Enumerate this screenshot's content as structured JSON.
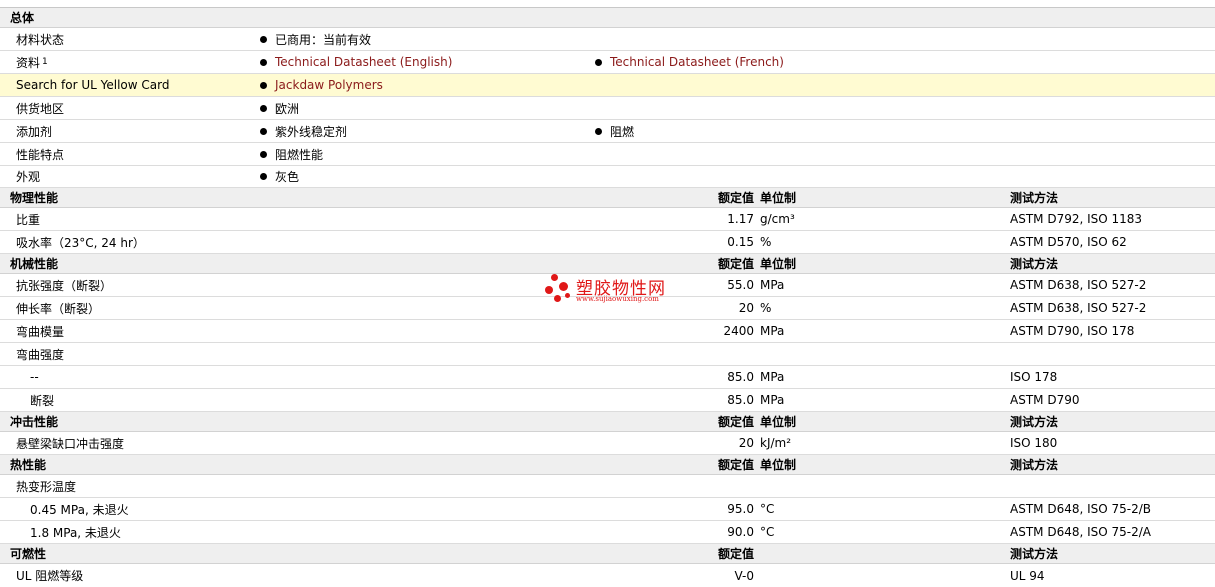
{
  "general": {
    "title": "总体",
    "material_status": {
      "label": "材料状态",
      "value": "已商用：当前有效"
    },
    "documents": {
      "label": "资料",
      "sup": "1",
      "links": [
        "Technical Datasheet (English)",
        "Technical Datasheet (French)"
      ]
    },
    "ul": {
      "label": "Search for UL Yellow Card",
      "link": "Jackdaw Polymers"
    },
    "region": {
      "label": "供货地区",
      "value": "欧洲"
    },
    "additives": {
      "label": "添加剂",
      "values": [
        "紫外线稳定剂",
        "阻燃"
      ]
    },
    "features": {
      "label": "性能特点",
      "value": "阻燃性能"
    },
    "appearance": {
      "label": "外观",
      "value": "灰色"
    }
  },
  "headers": {
    "nominal": "额定值",
    "unit": "单位制",
    "method": "测试方法"
  },
  "physical": {
    "title": "物理性能",
    "rows": [
      {
        "label": "比重",
        "value": "1.17",
        "unit": "g/cm³",
        "method": "ASTM D792, ISO 1183"
      },
      {
        "label": "吸水率（23°C, 24 hr）",
        "value": "0.15",
        "unit": "%",
        "method": "ASTM D570, ISO 62"
      }
    ]
  },
  "mechanical": {
    "title": "机械性能",
    "rows": [
      {
        "label": "抗张强度（断裂）",
        "value": "55.0",
        "unit": "MPa",
        "method": "ASTM D638, ISO 527-2"
      },
      {
        "label": "伸长率（断裂）",
        "value": "20",
        "unit": "%",
        "method": "ASTM D638, ISO 527-2"
      },
      {
        "label": "弯曲模量",
        "value": "2400",
        "unit": "MPa",
        "method": "ASTM D790, ISO 178"
      }
    ],
    "flex_strength": {
      "label": "弯曲强度",
      "rows": [
        {
          "label": "--",
          "value": "85.0",
          "unit": "MPa",
          "method": "ISO 178"
        },
        {
          "label": "断裂",
          "value": "85.0",
          "unit": "MPa",
          "method": "ASTM D790"
        }
      ]
    }
  },
  "impact": {
    "title": "冲击性能",
    "rows": [
      {
        "label": "悬壁梁缺口冲击强度",
        "value": "20",
        "unit": "kJ/m²",
        "method": "ISO 180"
      }
    ]
  },
  "thermal": {
    "title": "热性能",
    "hdt": {
      "label": "热变形温度",
      "rows": [
        {
          "label": "0.45 MPa, 未退火",
          "value": "95.0",
          "unit": "°C",
          "method": "ASTM D648, ISO 75-2/B"
        },
        {
          "label": "1.8 MPa, 未退火",
          "value": "90.0",
          "unit": "°C",
          "method": "ASTM D648, ISO 75-2/A"
        }
      ]
    }
  },
  "flammability": {
    "title": "可燃性",
    "rows": [
      {
        "label": "UL 阻燃等级",
        "value": "V-0",
        "method": "UL 94"
      }
    ]
  },
  "watermark": {
    "text": "塑胶物性网",
    "url": "www.sujiaowuxing.com",
    "color": "#e01818"
  },
  "colors": {
    "link": "#8b1a1a",
    "section_bg": "#efefef",
    "highlight_bg": "#fffbd2"
  }
}
